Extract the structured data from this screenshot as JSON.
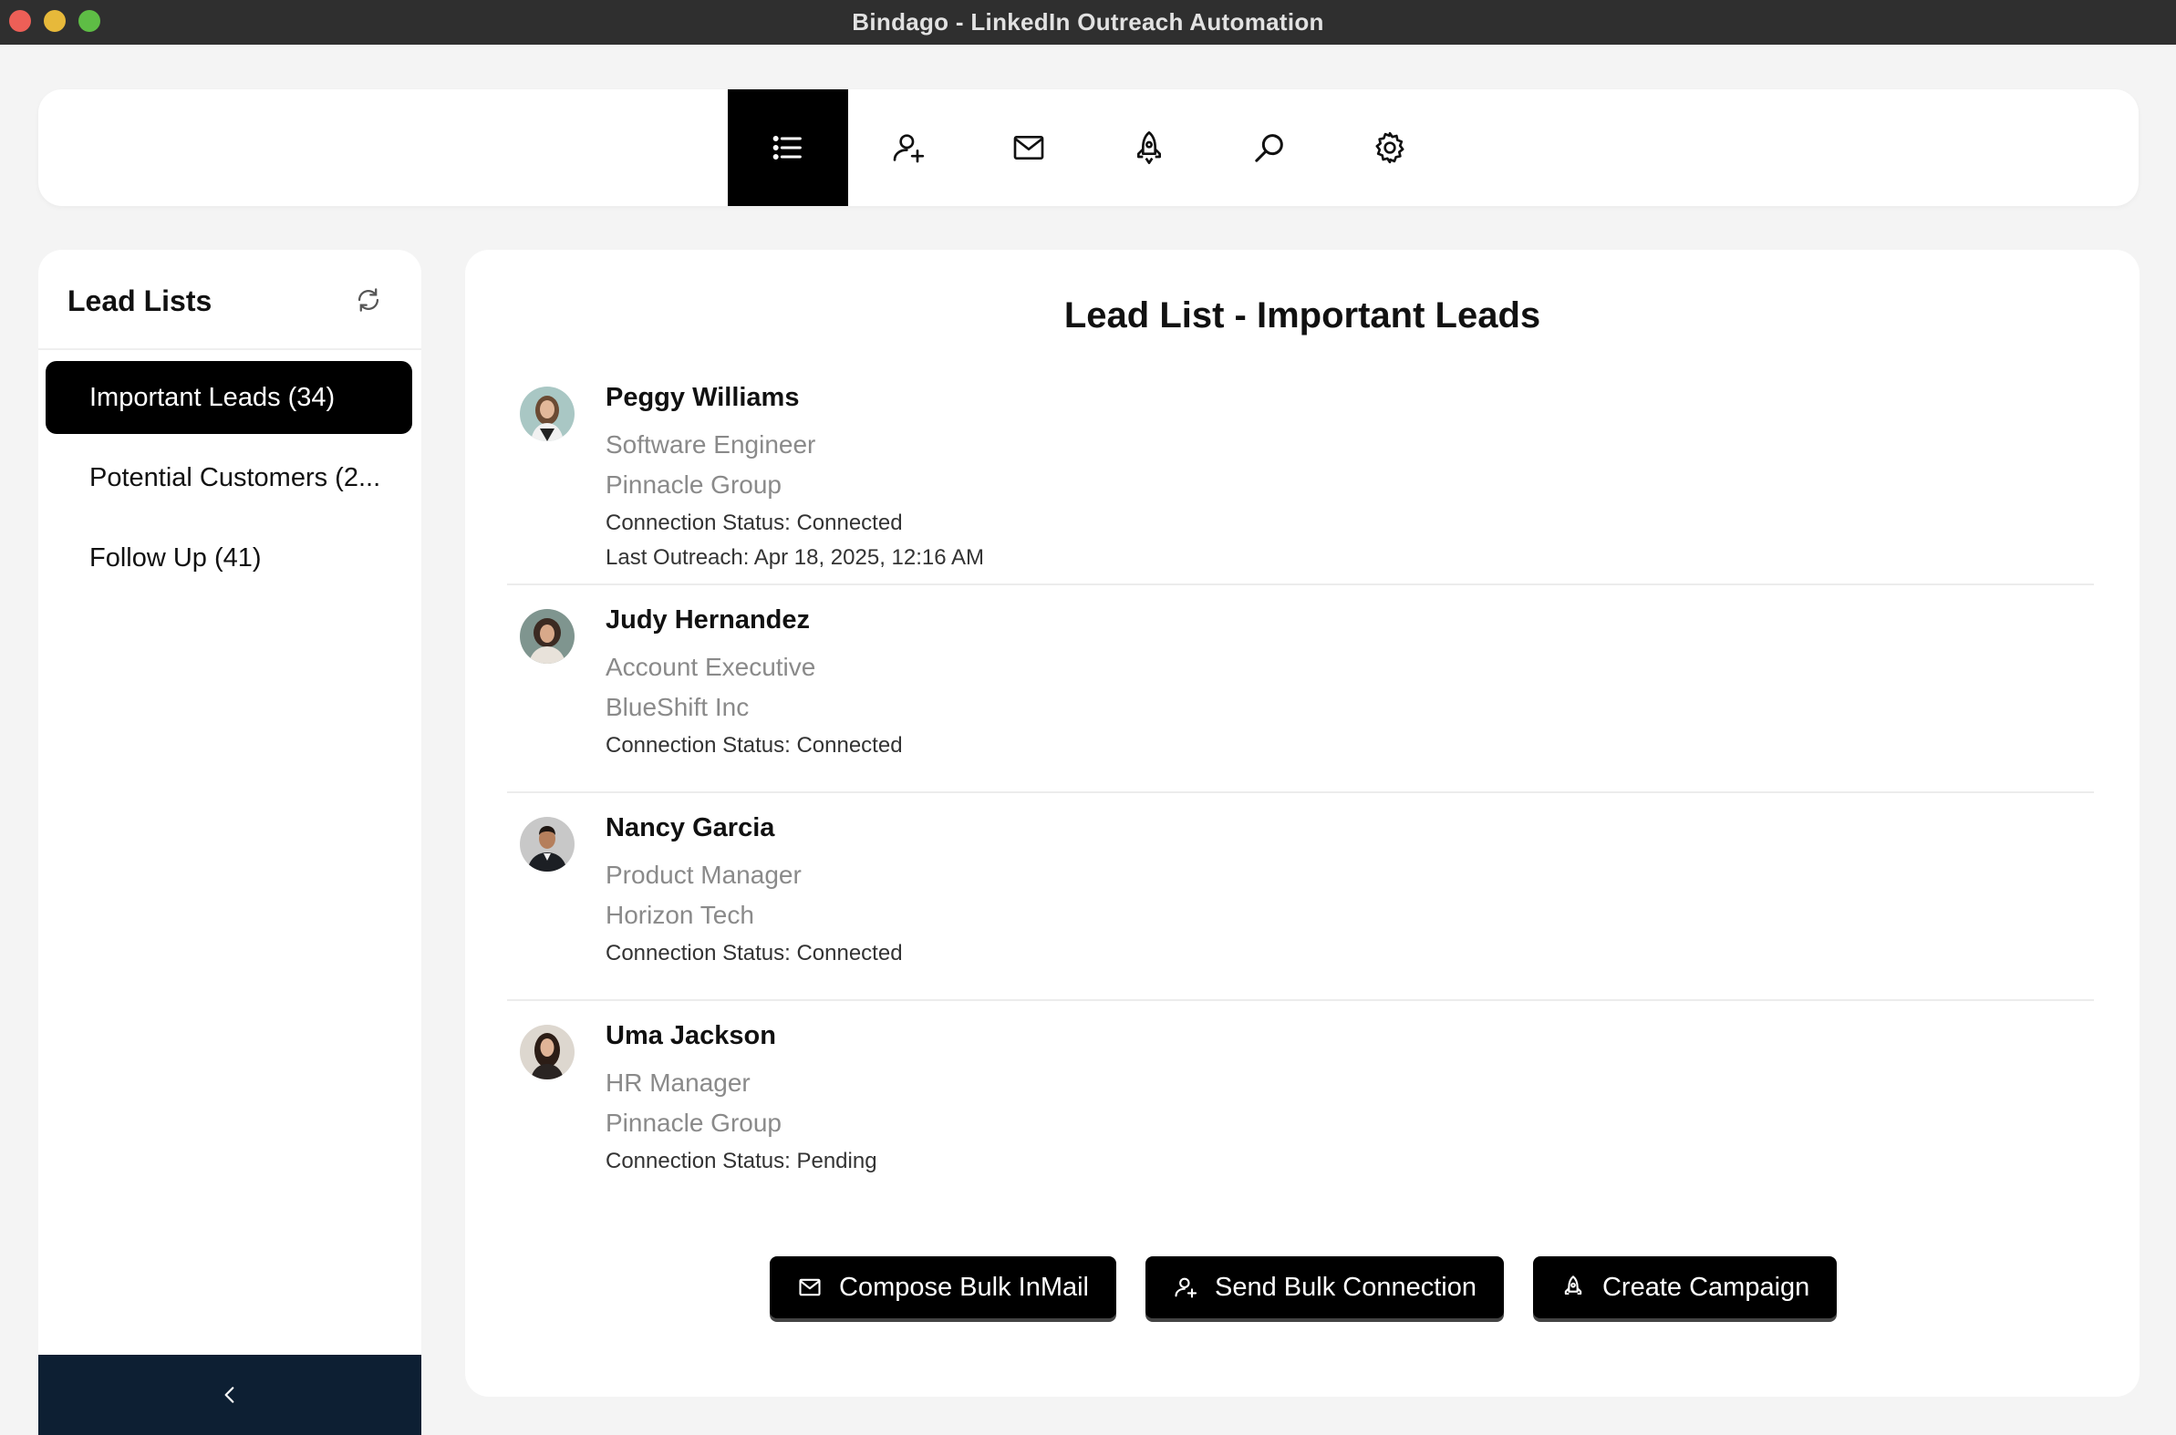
{
  "window": {
    "title": "Bindago - LinkedIn Outreach Automation"
  },
  "topnav": {
    "items": [
      {
        "icon": "list-icon",
        "active": true
      },
      {
        "icon": "add-user-icon",
        "active": false
      },
      {
        "icon": "mail-icon",
        "active": false
      },
      {
        "icon": "rocket-icon",
        "active": false
      },
      {
        "icon": "search-icon",
        "active": false
      },
      {
        "icon": "gear-icon",
        "active": false
      }
    ]
  },
  "sidebar": {
    "title": "Lead Lists",
    "items": [
      {
        "label": "Important Leads (34)",
        "active": true
      },
      {
        "label": "Potential Customers (2...",
        "active": false
      },
      {
        "label": "Follow Up (41)",
        "active": false
      }
    ],
    "collapse_icon": "chevron-left-icon"
  },
  "main": {
    "title": "Lead List - Important Leads",
    "leads": [
      {
        "name": "Peggy Williams",
        "title": "Software Engineer",
        "company": "Pinnacle Group",
        "status": "Connection Status: Connected",
        "last_outreach": "Last Outreach: Apr 18, 2025, 12:16 AM"
      },
      {
        "name": "Judy Hernandez",
        "title": "Account Executive",
        "company": "BlueShift Inc",
        "status": "Connection Status: Connected"
      },
      {
        "name": "Nancy Garcia",
        "title": "Product Manager",
        "company": "Horizon Tech",
        "status": "Connection Status: Connected"
      },
      {
        "name": "Uma Jackson",
        "title": "HR Manager",
        "company": "Pinnacle Group",
        "status": "Connection Status: Pending"
      }
    ],
    "actions": {
      "compose": "Compose Bulk InMail",
      "connect": "Send Bulk Connection",
      "campaign": "Create Campaign"
    }
  },
  "colors": {
    "accent": "#000000",
    "sidebar_footer": "#0d1f33",
    "titlebar": "#2f2f2f"
  }
}
